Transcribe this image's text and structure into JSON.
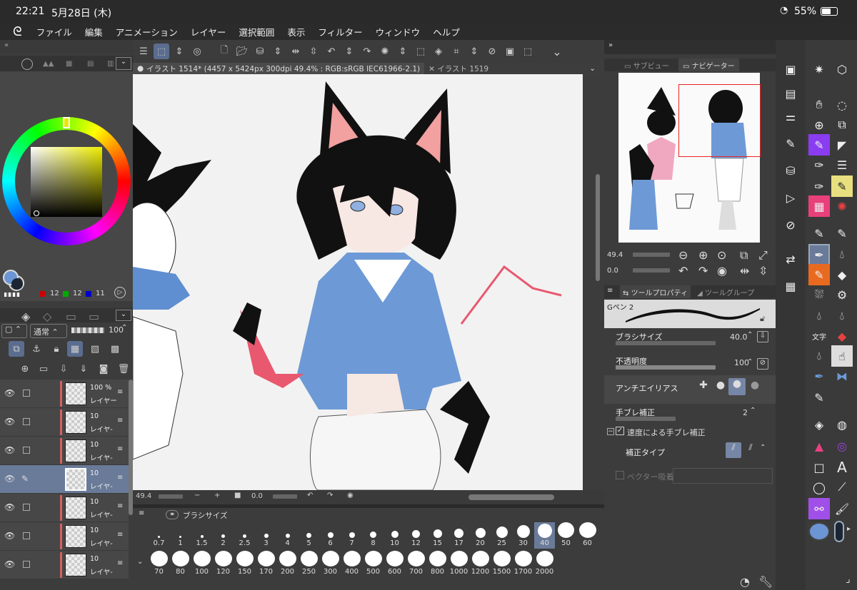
{
  "status": {
    "time": "22:21",
    "date": "5月28日 (木)",
    "battery": "55%"
  },
  "menu": [
    "ファイル",
    "編集",
    "アニメーション",
    "レイヤー",
    "選択範囲",
    "表示",
    "フィルター",
    "ウィンドウ",
    "ヘルプ"
  ],
  "tabs": {
    "active": "イラスト 1514* (4457 x 5424px 300dpi 49.4% : RGB:sRGB IEC61966-2.1)",
    "other": "イラスト 1519"
  },
  "color": {
    "r": "12",
    "g": "12",
    "b": "11",
    "main": "#1b2533",
    "sub": "#6c95d4"
  },
  "layer_controls": {
    "blend": "通常",
    "opacity": "100"
  },
  "layers": [
    {
      "opacity": "100 %",
      "name": "レイヤー"
    },
    {
      "opacity": "10",
      "name": "レイヤ-"
    },
    {
      "opacity": "10",
      "name": "レイヤ-"
    },
    {
      "opacity": "10",
      "name": "レイヤ-"
    },
    {
      "opacity": "10",
      "name": "レイヤ-"
    },
    {
      "opacity": "10",
      "name": "レイヤ-"
    },
    {
      "opacity": "10",
      "name": "レイヤ-"
    }
  ],
  "canvas_status": {
    "zoom": "49.4",
    "rotate": "0.0"
  },
  "brush_panel": {
    "title": "ブラシサイズ",
    "sizes_row1": [
      "0.7",
      "1",
      "1.5",
      "2",
      "2.5",
      "3",
      "4",
      "5",
      "6",
      "7",
      "8",
      "10",
      "12",
      "15",
      "17",
      "20",
      "25",
      "30",
      "40",
      "50",
      "60"
    ],
    "sizes_row2": [
      "70",
      "80",
      "100",
      "120",
      "150",
      "170",
      "200",
      "250",
      "300",
      "400",
      "500",
      "600",
      "700",
      "800",
      "1000",
      "1200",
      "1500",
      "1700",
      "2000"
    ],
    "selected": "40"
  },
  "navigator": {
    "tab1": "サブビュー",
    "tab2": "ナビゲーター",
    "zoom": "49.4",
    "rotate": "0.0"
  },
  "tool_property": {
    "tab1": "ツールプロパティ",
    "tab2": "ツールグループ",
    "brush": "Gペン 2",
    "brush_size_label": "ブラシサイズ",
    "brush_size": "40.0",
    "opacity_label": "不透明度",
    "opacity": "100",
    "antialias_label": "アンチエイリアス",
    "stabilization_label": "手ブレ補正",
    "stabilization": "2",
    "speed_stab_label": "速度による手ブレ補正",
    "correction_type_label": "補正タイプ",
    "vector_label": "ベクター吸着"
  },
  "toolbar": {
    "text_tool": "A"
  }
}
